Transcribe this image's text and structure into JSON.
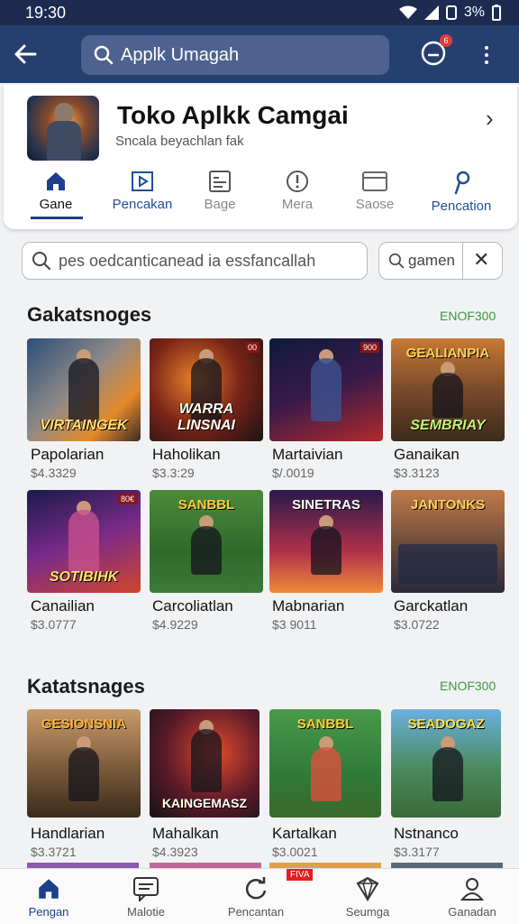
{
  "status": {
    "time": "19:30",
    "battery": "3%"
  },
  "search_top": {
    "text": "Applk Umagah"
  },
  "notif": {
    "count": "6"
  },
  "header": {
    "title": "Toko Aplkk Camgai",
    "subtitle": "Sncala beyachlan fak"
  },
  "tabs": [
    {
      "label": "Gane"
    },
    {
      "label": "Pencakan"
    },
    {
      "label": "Bage"
    },
    {
      "label": "Mera"
    },
    {
      "label": "Saose"
    },
    {
      "label": "Pencation"
    }
  ],
  "filter": {
    "text": "pes oedcanticanead ia essfancallah"
  },
  "chip": {
    "text": "gamen"
  },
  "sections": [
    {
      "title": "Gakatsnoges",
      "link": "ENOF300",
      "items": [
        {
          "name": "Papolarian",
          "price": "$4.3329",
          "art": "VIRTAINGEK",
          "top": "",
          "badge": ""
        },
        {
          "name": "Haholikan",
          "price": "$3.3:29",
          "art": "WARRA LINSNAI",
          "top": "",
          "badge": "00"
        },
        {
          "name": "Martaivian",
          "price": "$/.0019",
          "art": "",
          "top": "",
          "badge": "900"
        },
        {
          "name": "Ganaikan",
          "price": "$3.3123",
          "art": "SEMBRIAY",
          "top": "GEALIANPIA",
          "badge": ""
        },
        {
          "name": "Canailian",
          "price": "$3.0777",
          "art": "SOTIBIHK",
          "top": "",
          "badge": "80€"
        },
        {
          "name": "Carcoliatlan",
          "price": "$4.9229",
          "art": "",
          "top": "SANBBL",
          "badge": ""
        },
        {
          "name": "Mabnarian",
          "price": "$3 9011",
          "art": "",
          "top": "SINETRAS",
          "badge": ""
        },
        {
          "name": "Garckatlan",
          "price": "$3.0722",
          "art": "",
          "top": "JANTONKS",
          "badge": ""
        }
      ]
    },
    {
      "title": "Katatsnages",
      "link": "ENOF300",
      "items": [
        {
          "name": "Handlarian",
          "price": "$3.3721",
          "art": "",
          "top": "GESIONSNIA",
          "badge": ""
        },
        {
          "name": "Mahalkan",
          "price": "$4.3923",
          "art": "KAINGEMASZ",
          "top": "",
          "badge": ""
        },
        {
          "name": "Kartalkan",
          "price": "$3.0021",
          "art": "",
          "top": "SANBBL",
          "badge": ""
        },
        {
          "name": "Nstnanco",
          "price": "$3.3177",
          "art": "",
          "top": "SEADOGAZ",
          "badge": ""
        }
      ]
    }
  ],
  "bottomnav": [
    {
      "label": "Pengan"
    },
    {
      "label": "Malotie"
    },
    {
      "label": "Pencantan"
    },
    {
      "label": "Seumga"
    },
    {
      "label": "Ganadan"
    }
  ],
  "bottomnav_badge": "FIVA",
  "colors": {
    "appbar": "#25406f",
    "accent": "#1c3f8a",
    "link_green": "#3a9a3a"
  }
}
